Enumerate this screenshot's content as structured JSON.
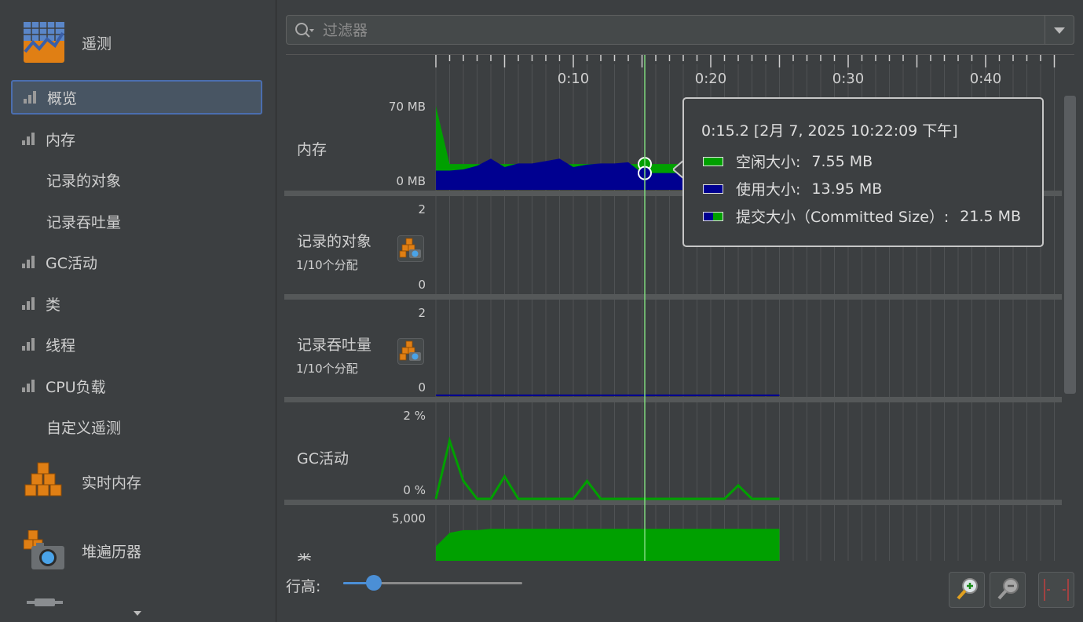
{
  "sidebar": {
    "telemetry_label": "遥测",
    "items": [
      {
        "label": "概览",
        "selected": true,
        "icon": "bar-chart-icon"
      },
      {
        "label": "内存",
        "icon": "bar-chart-icon"
      },
      {
        "label": "记录的对象"
      },
      {
        "label": "记录吞吐量"
      },
      {
        "label": "GC活动",
        "icon": "bar-chart-icon"
      },
      {
        "label": "类",
        "icon": "bar-chart-icon"
      },
      {
        "label": "线程",
        "icon": "bar-chart-icon"
      },
      {
        "label": "CPU负载",
        "icon": "bar-chart-icon"
      },
      {
        "label": "自定义遥测"
      }
    ],
    "live_memory_label": "实时内存",
    "heap_walker_label": "堆遍历器"
  },
  "filter": {
    "placeholder": "过滤器"
  },
  "timeline": {
    "ticks": [
      "0:10",
      "0:20",
      "0:30",
      "0:40"
    ]
  },
  "rows": [
    {
      "label": "内存",
      "ymax": "70 MB",
      "ymin": "0 MB"
    },
    {
      "label": "记录的对象",
      "sub": "1/10个分配",
      "ymax": "2",
      "ymin": "0"
    },
    {
      "label": "记录吞吐量",
      "sub": "1/10个分配",
      "ymax": "2",
      "ymin": "0"
    },
    {
      "label": "GC活动",
      "ymax": "2 %",
      "ymin": "0 %"
    },
    {
      "label": "类",
      "ymax": "5,000"
    }
  ],
  "tooltip": {
    "time": "0:15.2 [2月 7, 2025 10:22:09 下午]",
    "entries": [
      {
        "label": "空闲大小:",
        "value": "7.55 MB"
      },
      {
        "label": "使用大小:",
        "value": "13.95 MB"
      },
      {
        "label": "提交大小（Committed Size）:",
        "value": "21.5 MB"
      }
    ]
  },
  "bottom": {
    "row_height_label": "行高:",
    "row_height_fraction": 0.17
  },
  "colors": {
    "free": "#00a000",
    "used": "#000090",
    "cursor": "#7ed87e",
    "selection": "#4b6eaf"
  },
  "chart_data": [
    {
      "type": "area",
      "title": "内存",
      "x": [
        0,
        1,
        2,
        3,
        4,
        5,
        6,
        7,
        8,
        9,
        10,
        11,
        12,
        13,
        14,
        15,
        15.2,
        16,
        17,
        18,
        19,
        20,
        21,
        22,
        23,
        24,
        25
      ],
      "series": [
        {
          "name": "使用大小",
          "values": [
            16,
            16,
            17,
            20,
            26,
            19,
            22,
            22,
            24,
            26,
            19,
            21,
            22,
            22,
            23,
            14,
            13.95,
            14,
            14,
            14,
            14,
            14,
            14,
            14,
            14,
            14,
            14
          ]
        },
        {
          "name": "提交大小",
          "values": [
            70,
            21.5,
            21.5,
            21.5,
            21.5,
            21.5,
            21.5,
            21.5,
            21.5,
            21.5,
            21.5,
            21.5,
            21.5,
            21.5,
            21.5,
            21.5,
            21.5,
            21.5,
            21.5,
            21.5,
            21.5,
            21.5,
            21.5,
            21.5,
            21.5,
            21.5,
            21.5
          ]
        }
      ],
      "ylim": [
        0,
        70
      ]
    },
    {
      "type": "line",
      "title": "GC活动",
      "x": [
        0,
        1,
        2,
        3,
        4,
        5,
        6,
        7,
        8,
        9,
        10,
        11,
        12,
        13,
        14,
        15,
        16,
        17,
        18,
        19,
        20,
        21,
        22,
        23,
        24,
        25
      ],
      "values": [
        0,
        1.3,
        0.4,
        0,
        0,
        0.5,
        0,
        0,
        0,
        0,
        0,
        0.4,
        0,
        0,
        0,
        0,
        0,
        0,
        0,
        0,
        0,
        0,
        0.3,
        0,
        0,
        0
      ],
      "ylim": [
        0,
        2
      ]
    },
    {
      "type": "area",
      "title": "类",
      "x": [
        0,
        1,
        2,
        3,
        4,
        5,
        6,
        7,
        8,
        9,
        10,
        11,
        12,
        13,
        14,
        15,
        16,
        17,
        18,
        19,
        20,
        21,
        22,
        23,
        24,
        25
      ],
      "values": [
        4000,
        4500,
        4600,
        4600,
        4650,
        4650,
        4650,
        4650,
        4650,
        4650,
        4650,
        4650,
        4650,
        4650,
        4650,
        4650,
        4650,
        4650,
        4650,
        4650,
        4650,
        4650,
        4650,
        4650,
        4650,
        4650
      ],
      "ylim": [
        0,
        5000
      ]
    }
  ]
}
